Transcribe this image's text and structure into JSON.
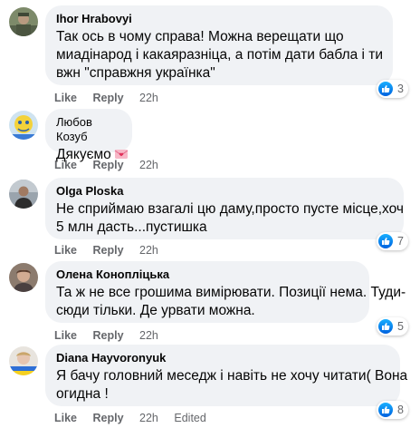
{
  "comments": [
    {
      "author": "Ihor Hrabovyi",
      "lines": [
        "Так ось в чому справа! Можна верещати що",
        "миадінарод і какаяразніца, а потім дати бабла і ти",
        "вжн \"справжня українка\""
      ],
      "like_label": "Like",
      "reply_label": "Reply",
      "time": "22h",
      "reaction_count": "3"
    },
    {
      "author": "Любов Козуб",
      "lines": [
        "Дякуємо"
      ],
      "like_label": "Like",
      "reply_label": "Reply",
      "time": "22h"
    },
    {
      "author": "Olga Ploska",
      "lines": [
        "Не сприймаю взагалі цю даму,просто пусте місце,хоч",
        "5 млн дасть...пустишка"
      ],
      "like_label": "Like",
      "reply_label": "Reply",
      "time": "22h",
      "reaction_count": "7"
    },
    {
      "author": "Олена Коноплiцька",
      "lines": [
        "Та ж не все грошима вимірювати. Позиції нема. Туди-",
        "сюди тільки. Де урвати можна."
      ],
      "like_label": "Like",
      "reply_label": "Reply",
      "time": "22h",
      "reaction_count": "5"
    },
    {
      "author": "Diana Hayvoronyuk",
      "lines": [
        "Я бачу головний меседж і навіть не хочу читати( Вона",
        "огидна !"
      ],
      "like_label": "Like",
      "reply_label": "Reply",
      "time": "22h",
      "edited_label": "Edited",
      "reaction_count": "8"
    }
  ],
  "colors": {
    "bubble": "#f0f2f5",
    "meta_text": "#65676b",
    "like_blue": "#0866ff"
  }
}
